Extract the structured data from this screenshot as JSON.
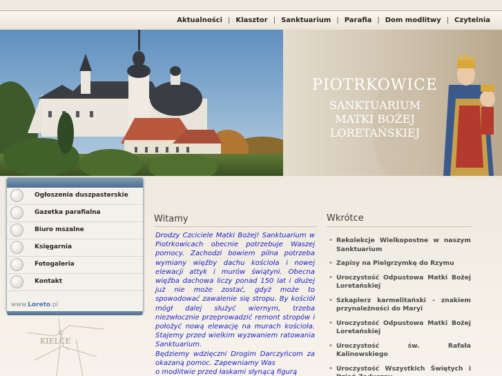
{
  "nav": [
    "Aktualności",
    "Klasztor",
    "Sanktuarium",
    "Parafia",
    "Dom modlitwy",
    "Czytelnia"
  ],
  "header": {
    "title": "PIOTRKOWICE",
    "subtitle": [
      "SANKTUARIUM",
      "MATKI BOŻEJ",
      "LORETAŃSKIEJ"
    ]
  },
  "sidebar": {
    "items": [
      "Ogłoszenia duszpasterskie",
      "Gazetka parafialna",
      "Biuro mszalne",
      "Księgarnia",
      "Fotogaleria",
      "Kontakt"
    ],
    "footer_prefix": "www.",
    "footer_brand": "Loreto",
    "footer_suffix": ".pl"
  },
  "map_label": "KIELCE",
  "witamy": {
    "title": "Witamy",
    "paragraphs": [
      "Drodzy Czciciele Matki Bożej! Sanktuarium w Piotrkowicach obecnie potrzebuje Waszej pomocy. Zachodzi bowiem pilna potrzeba wymiany więźby dachu kościoła i nowej elewacji attyk i murów świątyni. Obecna więźba dachowa liczy ponad 150 lat i dłużej już nie może zostać, gdyż może to spowodować zawalenie się stropu. By kościół mógł dalej służyć wiernym, trzeba niezwłocznie przeprowadzić remont stropów i położyć nową elewację na murach kościoła. Stajemy przed wielkim wyzwaniem ratowania Sanktuarium.",
      "Będziemy wdzięczni Drogim Darczyńcom za okazaną pomoc. Zapewniamy Was",
      "o modlitwie przed łaskami słynącą figurą"
    ]
  },
  "wkrotce": {
    "title": "Wkrótce",
    "items": [
      "Rekolekcje Wielkopostne w naszym Sanktuarium",
      "Zapisy na Pielgrzymkę do Rzymu",
      "Uroczystość Odpustowa Matki Bożej Loretańskiej",
      "Szkaplerz karmelitański - znakiem przynależności do Maryi",
      "Uroczystość Odpustowa Matki Bożej Loretańskiej",
      "Uroczystość św. Rafała Kalinowskiego",
      "Uroczystość Wszystkich Świętych i Dzień Zaduszny"
    ]
  },
  "colors": {
    "accent_text": "#1c22c8",
    "menu_bar": "#4f6f8f"
  }
}
